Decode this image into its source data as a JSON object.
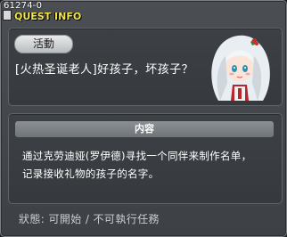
{
  "header": {
    "quest_id": "61274-0",
    "title": "QUEST INFO"
  },
  "tag": {
    "label": "活動"
  },
  "quest": {
    "name": "[火热圣诞老人]好孩子，坏孩子？"
  },
  "content": {
    "header": "内容",
    "lines": [
      "通过克劳迪娅(罗伊德)寻找一个同伴来制作名单，",
      "记录接收礼物的孩子的名字。"
    ]
  },
  "status": {
    "text": "狀態: 可開始 / 不可執行任務"
  },
  "colors": {
    "title": "#f2e64a",
    "panel": "#3a3e42"
  },
  "icons": {
    "npc": "npc-portrait-icon"
  }
}
